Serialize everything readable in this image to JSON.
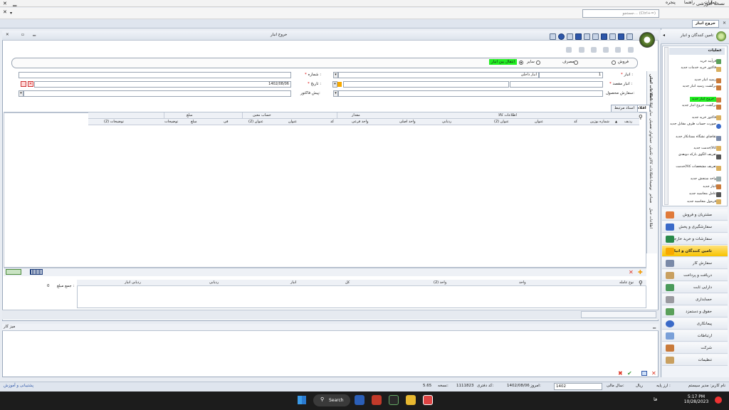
{
  "window": {
    "title": "نسخه آموزشی",
    "close": "✕",
    "minimize": "▁",
    "restore": "▫",
    "close_small": "✕",
    "menu_arrow": "▾"
  },
  "menubar": {
    "items": [
      "عملیات",
      "راهنما",
      "پنجره"
    ],
    "search_placeholder": "جستجو... (Ctrl+=)"
  },
  "doc_tab": {
    "label": "خروج انبار",
    "close": "✕"
  },
  "form": {
    "title": "خروج انبار",
    "radios": [
      {
        "label": "فروش",
        "selected": false
      },
      {
        "label": "مصرف",
        "selected": false
      },
      {
        "label": "سایر",
        "selected": false
      },
      {
        "label": "انتقال بین انبار",
        "selected": true
      }
    ],
    "fields": {
      "warehouse_label": "انبار :",
      "warehouse_value": "1",
      "warehouse_name": "انبار داخلی",
      "number_label": "شماره :",
      "dest_warehouse_label": "انبار مقصد :",
      "date_label": "تاریخ :",
      "date_value": "1402/08/06",
      "product_order_label": "سفارش محصول:",
      "prefactor_label": "پیش فاکتور:"
    },
    "vertical_tabs": [
      "اطلاعات اصلی",
      "سایر اطلاعات",
      "حسابهای تفصیلی",
      "اطلاعات کالای تکمیلی",
      "توضیحات",
      "ضمائم",
      "اطلاعات حمل"
    ],
    "item_tabs": [
      "اقلام",
      "اسناد مرتبط"
    ],
    "grid": {
      "group_headers": [
        "اطلاعات کالا",
        "مقدار",
        "حساب معین",
        "مبلغ"
      ],
      "columns": [
        "ردیف",
        "شماره بوژین",
        "کد",
        "عنوان",
        "عنوان (2)",
        "ردیابی",
        "واحد اصلی",
        "واحد فرعی",
        "کد",
        "عنوان",
        "عنوان (2)",
        "فی",
        "مبلغ",
        "توضیحات",
        "توضیحات (2)"
      ],
      "sort_icon": "▲"
    },
    "sub_grid": {
      "columns": [
        "نوع عامله",
        "واحد",
        "واحد (2)",
        "کل",
        "انبار",
        "ردیابی",
        "ردیابی انبار"
      ],
      "total_label": "جمع مبلغ :",
      "total_value": "0"
    }
  },
  "worktable": {
    "title": "میز کار"
  },
  "sidebar": {
    "title": "تامین کنندگان و انبار",
    "ops_title": "عملیات",
    "operations": [
      "فرآیند خرید",
      "فاکتور خرید خدمات جدید",
      "رسید انبار جدید",
      "برگشت رسید انبار جدید",
      "خروج انبار جدید",
      "برگشت خروج انبار جدید",
      "فاکتور خرید جدید",
      "صورت حساب طرف مقابل جدید",
      "تقاضای نشگاه بستانکار جدید",
      "کالا/خدمت جدید",
      "تعریف الگوی بارکد دوبعدی",
      "تعریف مشخصات کالا/خدمت",
      "واحد سنجش جدید",
      "انبار جدید",
      "عامل محاسبه جدید",
      "فرمول محاسبه جدید"
    ],
    "highlighted_index": 4,
    "modules": [
      "مشتریان و فروش",
      "سفارشگیری و پخش",
      "سفارشات و خرید خارجی",
      "تامین کنندگان و انبار",
      "سفارش کار",
      "دریافت و پرداخت",
      "دارایی ثابت",
      "حسابداری",
      "حقوق و دستمزد",
      "پیمانکاری",
      "ارتباطات",
      "شرکت",
      "تنظیمات"
    ],
    "active_module_index": 3
  },
  "statusbar": {
    "user": "نام کاربر: مدیر سیستم",
    "db": "ارز پایه :",
    "currency": "ریال",
    "fiscal_label": "سال مالی:",
    "fiscal_value": "1402",
    "today_label": "امروز:",
    "today_value": "1402/08/06",
    "office_label": "کد دفتری:",
    "office_value": "1111823",
    "version_label": "نسخه:",
    "version_value": "5.65",
    "support": "پشتیبانی و آموزش"
  },
  "taskbar": {
    "search": "Search",
    "time": "5:17 PM",
    "date": "10/28/2023",
    "lang": "فا"
  },
  "colors": {
    "highlight": "#22ee22",
    "active_module": "#f7c200",
    "accent": "#2d56a8"
  }
}
